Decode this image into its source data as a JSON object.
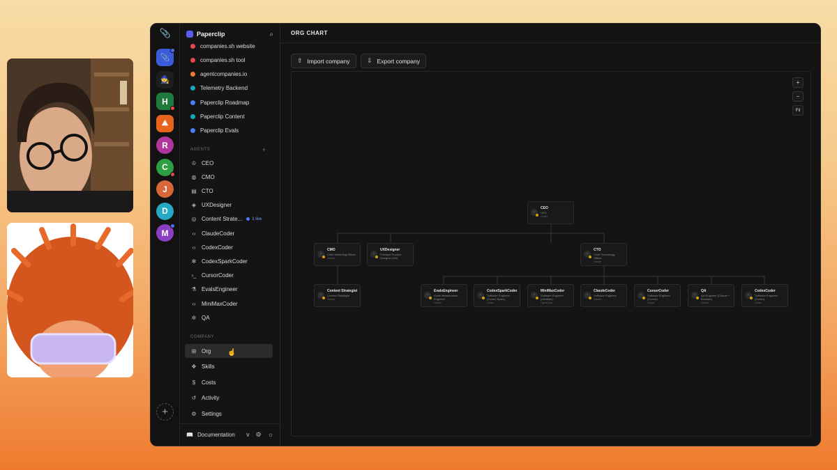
{
  "sidebar": {
    "app_name": "Paperclip",
    "projects": [
      {
        "label": "companies.sh website",
        "color": "#e5484d"
      },
      {
        "label": "companies.sh tool",
        "color": "#e5484d"
      },
      {
        "label": "agentcompanies.io",
        "color": "#f07a2b"
      },
      {
        "label": "Telemetry Backend",
        "color": "#15a8c0"
      },
      {
        "label": "Paperclip Roadmap",
        "color": "#4b7cf5"
      },
      {
        "label": "Paperclip Content",
        "color": "#15a8c0"
      },
      {
        "label": "Paperclip Evals",
        "color": "#4b7cf5"
      }
    ],
    "agents_label": "AGENTS",
    "agents": [
      {
        "label": "CEO",
        "icon": "crown-icon"
      },
      {
        "label": "CMO",
        "icon": "globe-icon"
      },
      {
        "label": "CTO",
        "icon": "file-icon"
      },
      {
        "label": "UXDesigner",
        "icon": "gem-icon"
      },
      {
        "label": "Content Strate...",
        "icon": "target-icon",
        "live": "1 live"
      },
      {
        "label": "ClaudeCoder",
        "icon": "code-icon"
      },
      {
        "label": "CodexCoder",
        "icon": "code-icon"
      },
      {
        "label": "CodexSparkCoder",
        "icon": "sparkle-icon"
      },
      {
        "label": "CursorCoder",
        "icon": "terminal-icon"
      },
      {
        "label": "EvalsEngineer",
        "icon": "flask-icon"
      },
      {
        "label": "MiniMaxCoder",
        "icon": "code-icon"
      },
      {
        "label": "QA",
        "icon": "bug-icon"
      }
    ],
    "company_label": "COMPANY",
    "company": [
      {
        "label": "Org",
        "icon": "org-icon",
        "active": true
      },
      {
        "label": "Skills",
        "icon": "boxes-icon"
      },
      {
        "label": "Costs",
        "icon": "dollar-icon"
      },
      {
        "label": "Activity",
        "icon": "history-icon"
      },
      {
        "label": "Settings",
        "icon": "gear-icon"
      }
    ],
    "footer": {
      "documentation": "Documentation",
      "version": "v"
    }
  },
  "rail": {
    "companies": [
      {
        "initial": "",
        "color": "#3b5bdb",
        "icon": "paperclip-icon",
        "square": true,
        "dot": "blue"
      },
      {
        "initial": "",
        "color": "#1e1e1e",
        "icon": "wizard-icon",
        "square": true
      },
      {
        "initial": "H",
        "color": "#1f7a3d",
        "icon": "",
        "square": true,
        "dot": "red"
      },
      {
        "initial": "",
        "color": "#e8631c",
        "icon": "mountain-icon",
        "square": true
      },
      {
        "initial": "R",
        "color": "#b0369e"
      },
      {
        "initial": "C",
        "color": "#2e9e43",
        "dot": "red"
      },
      {
        "initial": "J",
        "color": "#d9663a"
      },
      {
        "initial": "D",
        "color": "#27a9c4"
      },
      {
        "initial": "M",
        "color": "#8a3fc2",
        "dot": "blue"
      }
    ]
  },
  "main": {
    "title": "ORG CHART",
    "import_label": "Import company",
    "export_label": "Export company",
    "zoom_in": "+",
    "zoom_out": "−",
    "fit": "Fit"
  },
  "org": [
    {
      "name": "CEO",
      "role": "CEO",
      "model": "Codex"
    },
    {
      "name": "CMO",
      "role": "Chief Marketing Officer",
      "model": "Claude"
    },
    {
      "name": "UXDesigner",
      "role": "Principal Product Designer (UX)",
      "model": ""
    },
    {
      "name": "CTO",
      "role": "Chief Technology Officer",
      "model": "Claude"
    },
    {
      "name": "Content Strategist",
      "role": "Content Strategist",
      "model": "Claude"
    },
    {
      "name": "EvalsEngineer",
      "role": "Evals Infrastructure Engineer",
      "model": "Claude"
    },
    {
      "name": "CodexSparkCoder",
      "role": "Software Engineer (Codex Spark)",
      "model": "Codex"
    },
    {
      "name": "MiniMaxCoder",
      "role": "Software Engineer (MiniMax)",
      "model": "OpenCode"
    },
    {
      "name": "ClaudeCoder",
      "role": "Software Engineer",
      "model": "Claude"
    },
    {
      "name": "CursorCoder",
      "role": "Software Engineer (Cursor)",
      "model": "Cursor"
    },
    {
      "name": "QA",
      "role": "QA Engineer (Claude + Browser)",
      "model": "Claude"
    },
    {
      "name": "CodexCoder",
      "role": "Software Engineer (Codex)",
      "model": "Codex"
    }
  ]
}
